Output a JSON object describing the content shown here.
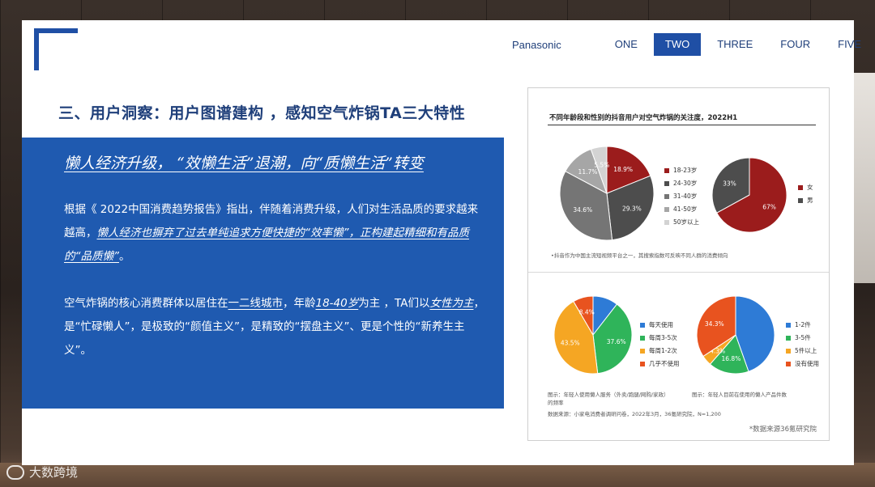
{
  "nav": {
    "brand": "Panasonic",
    "items": [
      {
        "label": "ONE",
        "active": false
      },
      {
        "label": "TWO",
        "active": true
      },
      {
        "label": "THREE",
        "active": false
      },
      {
        "label": "FOUR",
        "active": false
      },
      {
        "label": "FIVE",
        "active": false
      }
    ]
  },
  "title": "三、用户洞察：用户图谱建构 ，感知空气炸锅TA三大特性",
  "panel": {
    "subtitle": "懒人经济升级，    “效懒生活”退潮，向“质懒生活”转变",
    "p1_a": "根据《 2022中国消费趋势报告》指出，伴随着消费升级，人们对生活品质的要求越来越高，",
    "p1_u": "懒人经济也摒弃了过去单纯追求方便快捷的“效率懒”，正构建起精细和有品质的“品质懒”",
    "p1_b": "。",
    "p2_a": "空气炸锅的核心消费群体以居住在",
    "p2_u1": "一二线城市",
    "p2_b": "，年龄",
    "p2_u2": "18-40岁",
    "p2_c": "为主 ，TA们以",
    "p2_u3": "女性为主",
    "p2_d": "，是“忙碌懒人”，是极致的“颜值主义”，是精致的“摆盘主义”、更是个性的“新养生主义”。"
  },
  "card": {
    "title": "不同年龄段和性别的抖音用户对空气炸锅的关注度，2022H1",
    "footnote": "•抖音作为中国主流短视频平台之一，其搜索指数可反映不同人群的消费倾向",
    "cap_left": "图示：年轻人使用懒人服务（外卖/跑腿/网购/家政）的频率",
    "cap_right": "图示：年轻人目前在使用的懒人产品件数",
    "cap_source": "数据来源：小家电消费者调研问卷，2022年3月，36氪研究院，N=1,200",
    "source_note": "*数据来源36氪研究院"
  },
  "watermark": "大数跨境",
  "chart_data": [
    {
      "type": "pie",
      "title": "age",
      "categories": [
        "18-23岁",
        "24-30岁",
        "31-40岁",
        "41-50岁",
        "50岁以上"
      ],
      "values": [
        18.9,
        29.3,
        34.6,
        11.7,
        5.5
      ],
      "colors": [
        "#9b1c1c",
        "#4d4d4d",
        "#757575",
        "#a6a6a6",
        "#d3d3d3"
      ],
      "labels": [
        "18.9%",
        "29.3%",
        "34.6%",
        "11.7%",
        "5.5%"
      ]
    },
    {
      "type": "pie",
      "title": "gender",
      "categories": [
        "女",
        "男"
      ],
      "values": [
        67,
        33
      ],
      "colors": [
        "#9b1c1c",
        "#4d4d4d"
      ],
      "labels": [
        "67%",
        "33%"
      ]
    },
    {
      "type": "pie",
      "title": "frequency",
      "categories": [
        "每天使用",
        "每周3-5次",
        "每周1-2次",
        "几乎不使用"
      ],
      "values": [
        10.5,
        37.6,
        43.5,
        8.4
      ],
      "colors": [
        "#2e7bd6",
        "#2fb45a",
        "#f5a623",
        "#e8531f"
      ],
      "labels": [
        "",
        "37.6%",
        "43.5%",
        "8.4%"
      ]
    },
    {
      "type": "pie",
      "title": "count",
      "categories": [
        "1-2件",
        "3-5件",
        "5件以上",
        "没有使用"
      ],
      "values": [
        44.6,
        16.8,
        4.3,
        34.3
      ],
      "colors": [
        "#2e7bd6",
        "#2fb45a",
        "#f5a623",
        "#e8531f"
      ],
      "labels": [
        "",
        "16.8%",
        "4.3%",
        "34.3%"
      ]
    }
  ]
}
